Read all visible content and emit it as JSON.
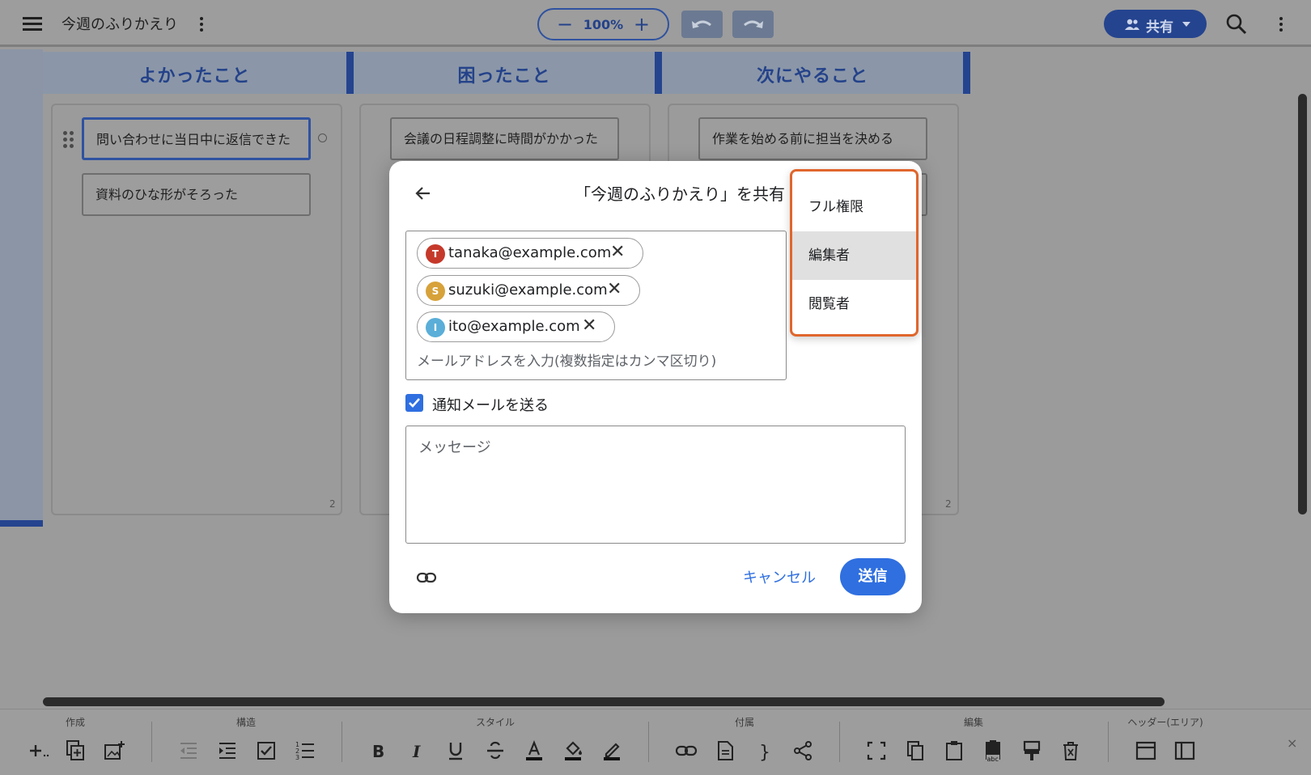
{
  "app": {
    "doc_title": "今週のふりかえり",
    "zoom": {
      "minus": "−",
      "value": "100%",
      "plus": "+"
    },
    "share_label": "共有"
  },
  "columns": [
    {
      "title": "よかったこと",
      "cards": [
        "問い合わせに当日中に返信できた",
        "資料のひな形がそろった"
      ],
      "count": "2"
    },
    {
      "title": "困ったこと",
      "cards": [
        "会議の日程調整に時間がかかった"
      ],
      "count": ""
    },
    {
      "title": "次にやること",
      "cards": [
        "作業を始める前に担当を決める",
        ""
      ],
      "count": "2"
    }
  ],
  "toolbar": {
    "groups": [
      "作成",
      "構造",
      "スタイル",
      "付属",
      "編集",
      "ヘッダー(エリア)"
    ],
    "close": "×"
  },
  "share_dialog": {
    "title": "「今週のふりかえり」を共有",
    "recipients": [
      {
        "initial": "T",
        "email": "tanaka@example.com",
        "color": "#c5392b"
      },
      {
        "initial": "S",
        "email": "suzuki@example.com",
        "color": "#d7a23a"
      },
      {
        "initial": "I",
        "email": "ito@example.com",
        "color": "#5aaed8"
      }
    ],
    "recipient_placeholder": "メールアドレスを入力(複数指定はカンマ区切り)",
    "notify_label": "通知メールを送る",
    "notify_checked": true,
    "message_placeholder": "メッセージ",
    "cancel_label": "キャンセル",
    "send_label": "送信"
  },
  "role_dropdown": {
    "options": [
      "フル権限",
      "編集者",
      "閲覧者"
    ],
    "highlighted": "編集者"
  },
  "colors": {
    "accent": "#2f6fe0",
    "dark_blue": "#25448f",
    "dropdown_border": "#e0662c"
  }
}
